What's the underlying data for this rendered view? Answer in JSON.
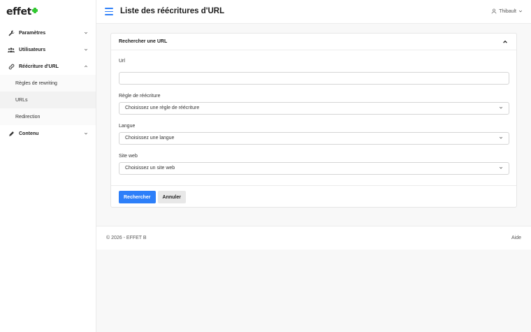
{
  "brand": {
    "logo_text": "effet"
  },
  "header": {
    "title": "Liste des réécritures d'URL",
    "user_name": "Thibault"
  },
  "sidebar": {
    "items": [
      {
        "label": "Paramètres",
        "icon": "wrench-icon"
      },
      {
        "label": "Utilisateurs",
        "icon": "users-icon"
      },
      {
        "label": "Réécriture d'URL",
        "icon": "link-icon",
        "expanded": true
      },
      {
        "label": "Contenu",
        "icon": "pencil-icon"
      }
    ],
    "subitems": [
      {
        "label": "Règles de rewriting"
      },
      {
        "label": "URLs",
        "active": true
      },
      {
        "label": "Redirection"
      }
    ]
  },
  "search_card": {
    "title": "Rechercher une URL",
    "url_label": "Url",
    "url_value": "",
    "rule_label": "Règle de réécriture",
    "rule_selected": "Choisissez une règle de réécriture",
    "language_label": "Langue",
    "language_selected": "Choisissez une langue",
    "website_label": "Site web",
    "website_selected": "Choisissez un site web",
    "search_button": "Rechercher",
    "cancel_button": "Annuler"
  },
  "footer": {
    "copyright": "© 2026 - EFFET B",
    "help": "Aide"
  },
  "colors": {
    "accent": "#2d7ff9",
    "logo_mark": "#32c832"
  }
}
